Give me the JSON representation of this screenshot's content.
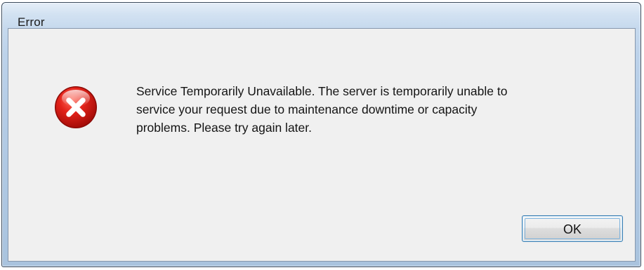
{
  "window": {
    "title": "Error"
  },
  "dialog": {
    "icon": "error-icon",
    "message": "Service Temporarily Unavailable. The server is temporarily unable to\nservice your request due to maintenance downtime or capacity\nproblems. Please try again later."
  },
  "buttons": {
    "ok_label": "OK"
  },
  "colors": {
    "icon_red": "#d8150f",
    "title_bar": "#b9d1ea",
    "client_background": "#f0f0f0",
    "button_border": "#3c7fb1"
  }
}
